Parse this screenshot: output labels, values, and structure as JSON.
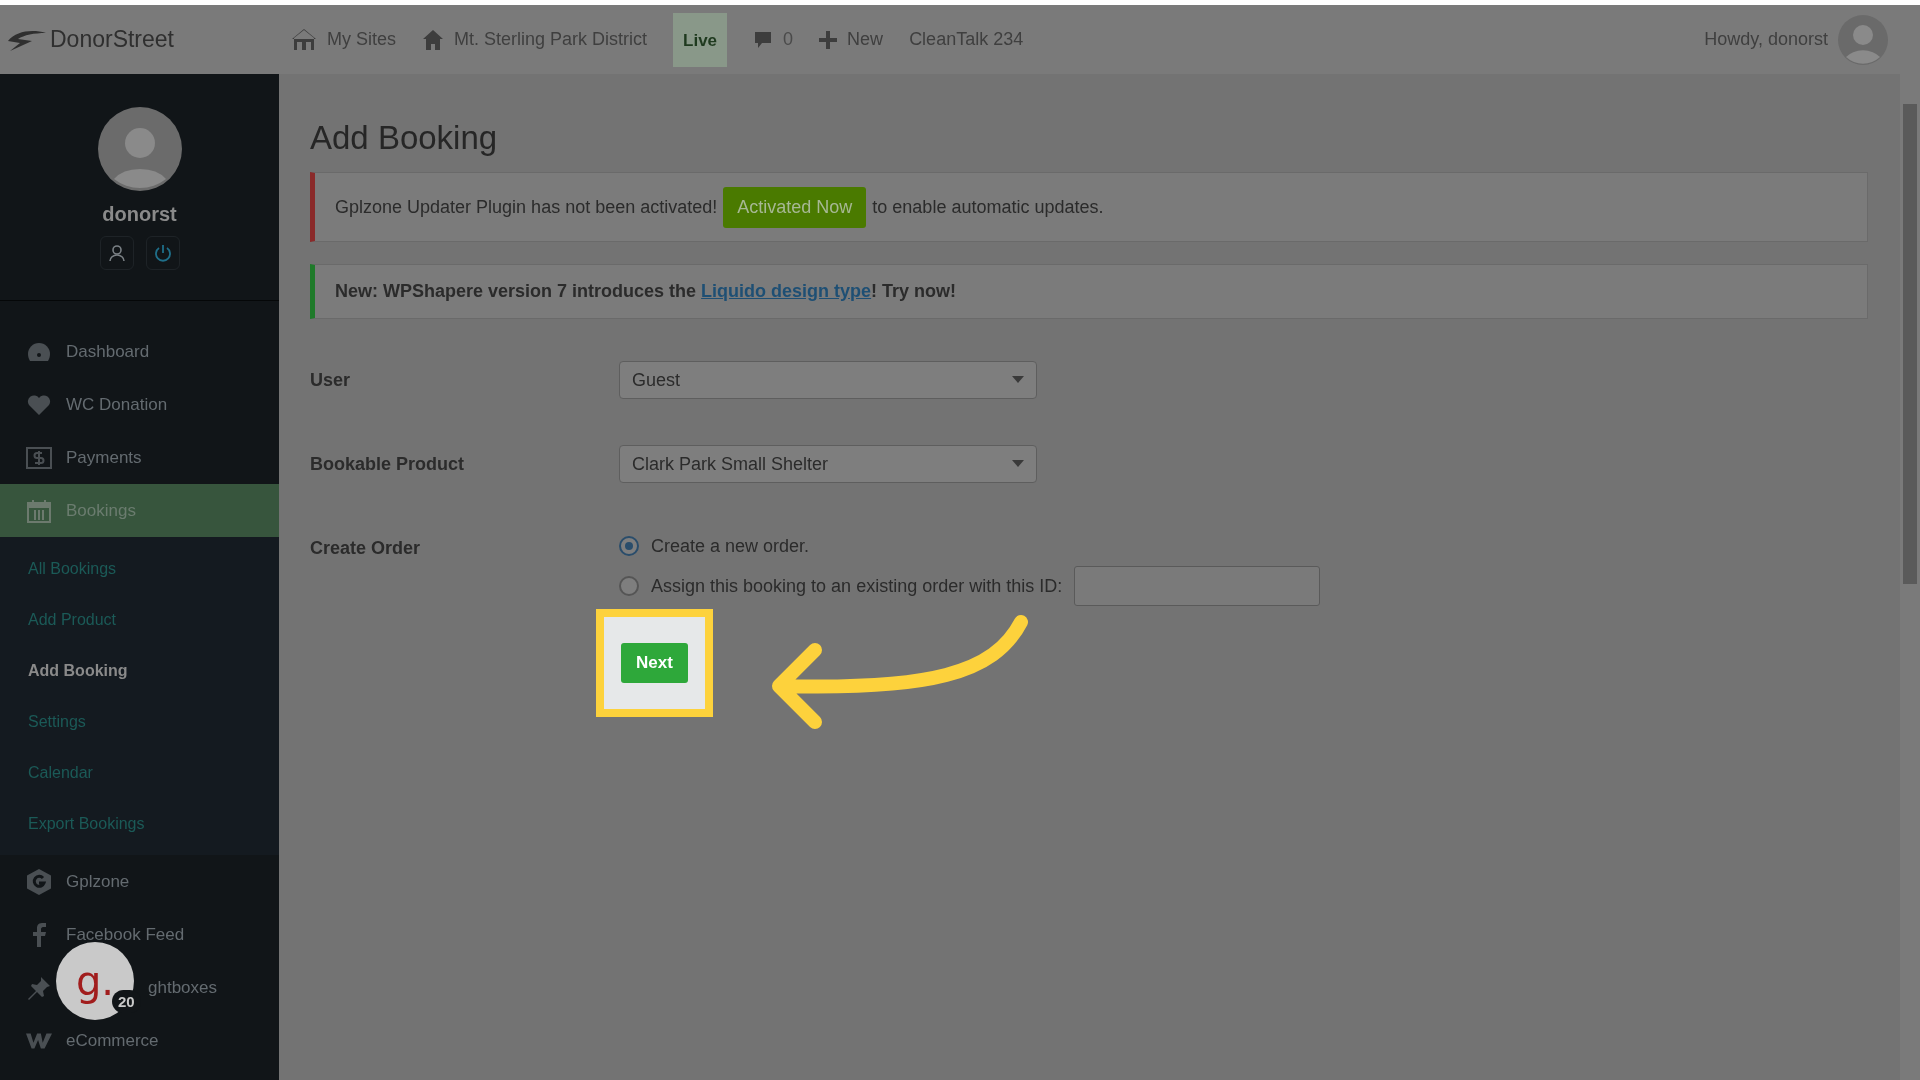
{
  "topbar": {
    "logo": "DonorStreet",
    "items": [
      {
        "kind": "sites",
        "label": "My Sites"
      },
      {
        "kind": "home",
        "label": "Mt. Sterling Park District"
      },
      {
        "kind": "badge",
        "label": "Live"
      },
      {
        "kind": "comments",
        "label": "0"
      },
      {
        "kind": "new",
        "label": "New"
      },
      {
        "kind": "text",
        "label": "CleanTalk 234"
      }
    ],
    "greeting": "Howdy, donorst"
  },
  "sidebar": {
    "username": "donorst",
    "menu": [
      {
        "label": "Dashboard",
        "selected": false
      },
      {
        "label": "WC Donation",
        "selected": false
      },
      {
        "label": "Payments",
        "selected": false
      },
      {
        "label": "Bookings",
        "selected": true,
        "children": [
          {
            "label": "All Bookings",
            "selected": false
          },
          {
            "label": "Add Product",
            "selected": false
          },
          {
            "label": "Add Booking",
            "selected": true
          },
          {
            "label": "Settings",
            "selected": false
          },
          {
            "label": "Calendar",
            "selected": false
          },
          {
            "label": "Export Bookings",
            "selected": false
          }
        ]
      },
      {
        "label": "Gplzone",
        "selected": false
      },
      {
        "label": "Facebook Feed",
        "selected": false
      },
      {
        "label": "ghtboxes",
        "selected": false
      },
      {
        "label": "eCommerce",
        "selected": false
      }
    ]
  },
  "chat_badge": {
    "letter": "g.",
    "count": "20"
  },
  "page": {
    "title": "Add Booking",
    "notices": [
      {
        "kind": "error",
        "before": "Gplzone Updater Plugin has not been activated!",
        "button": "Activated Now",
        "after": "to enable automatic updates."
      },
      {
        "kind": "success",
        "before": "New: WPShapere version 7 introduces the",
        "link": "Liquido design type",
        "after": "! Try now!"
      }
    ],
    "form": [
      {
        "kind": "select",
        "label": "User",
        "value": "Guest"
      },
      {
        "kind": "select",
        "label": "Bookable Product",
        "value": "Clark Park Small Shelter"
      },
      {
        "kind": "radio",
        "label": "Create Order",
        "options": [
          {
            "label": "Create a new order.",
            "selected": true
          },
          {
            "label": "Assign this booking to an existing order with this ID:",
            "selected": false,
            "has_field": true
          }
        ]
      }
    ],
    "submit": "Next"
  }
}
